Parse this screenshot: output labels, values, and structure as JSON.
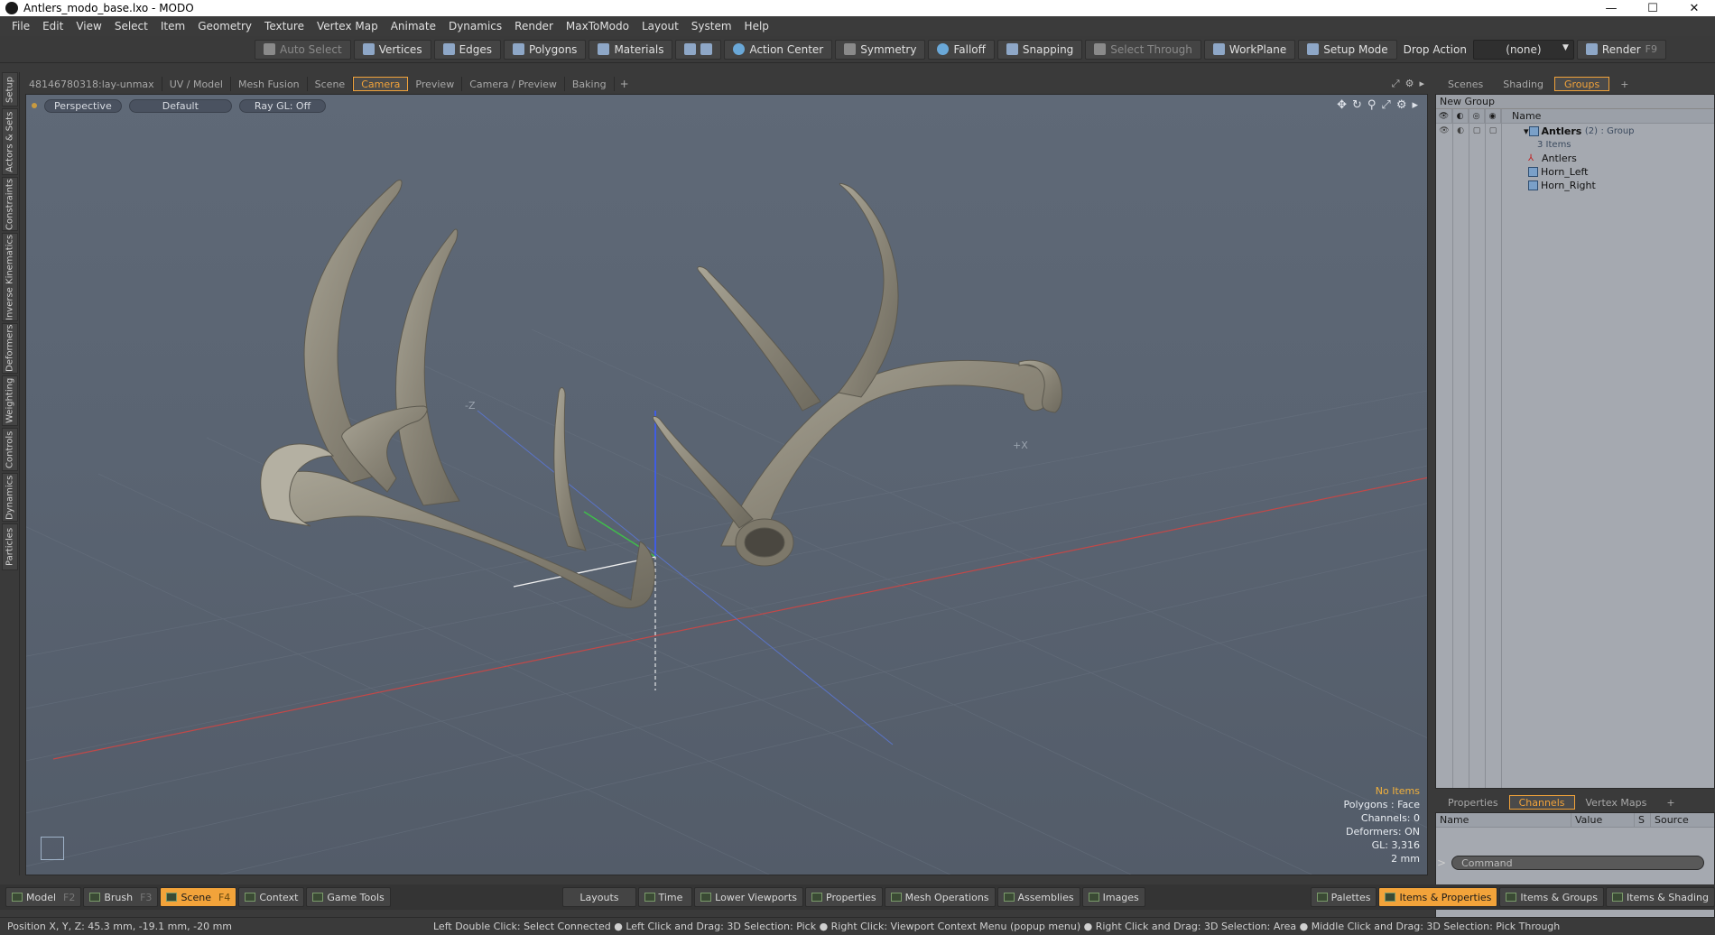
{
  "window": {
    "title": "Antlers_modo_base.lxo - MODO",
    "minimize": "—",
    "maximize": "☐",
    "close": "✕"
  },
  "menu": [
    "File",
    "Edit",
    "View",
    "Select",
    "Item",
    "Geometry",
    "Texture",
    "Vertex Map",
    "Animate",
    "Dynamics",
    "Render",
    "MaxToModo",
    "Layout",
    "System",
    "Help"
  ],
  "toolbar": {
    "auto_select": "Auto Select",
    "vertices": "Vertices",
    "edges": "Edges",
    "polygons": "Polygons",
    "materials": "Materials",
    "action_center": "Action Center",
    "symmetry": "Symmetry",
    "falloff": "Falloff",
    "snapping": "Snapping",
    "select_through": "Select Through",
    "workplane": "WorkPlane",
    "setup_mode": "Setup Mode",
    "drop_action": "Drop Action",
    "drop_value": "(none)",
    "render": "Render",
    "render_key": "F9"
  },
  "left_tabs": [
    "Setup",
    "Actors & Sets",
    "Constraints",
    "Inverse Kinematics",
    "Deformers",
    "Weighting",
    "Controls",
    "Dynamics",
    "Particles"
  ],
  "viewport_tabs": {
    "items": [
      "48146780318:lay-unmax",
      "UV / Model",
      "Mesh Fusion",
      "Scene",
      "Camera",
      "Preview",
      "Camera / Preview",
      "Baking"
    ],
    "active": "Camera",
    "add": "+"
  },
  "viewport": {
    "view_mode": "Perspective",
    "shading": "Default",
    "raygl": "Ray GL: Off",
    "axis_neg_z": "-Z",
    "axis_pos_x": "+X",
    "hud": {
      "selection": "No Items",
      "polygons": "Polygons : Face",
      "channels": "Channels: 0",
      "deformers": "Deformers: ON",
      "gl": "GL: 3,316",
      "scale": "2 mm"
    }
  },
  "right_tabs": {
    "items": [
      "Scenes",
      "Shading",
      "Groups"
    ],
    "active": "Groups",
    "add": "+"
  },
  "groups": {
    "new_group": "New Group",
    "name_col": "Name",
    "root": {
      "name": "Antlers",
      "count": "(2)",
      "type": ": Group",
      "sub": "3 Items"
    },
    "children": [
      "Antlers",
      "Horn_Left",
      "Horn_Right"
    ]
  },
  "channel_tabs": {
    "items": [
      "Properties",
      "Channels",
      "Vertex Maps"
    ],
    "active": "Channels",
    "add": "+"
  },
  "channels": {
    "cols": [
      "Name",
      "Value",
      "S",
      "Source"
    ]
  },
  "command": {
    "placeholder": "Command",
    "arrow": ">"
  },
  "bottom_bar": {
    "left": [
      {
        "label": "Model",
        "key": "F2"
      },
      {
        "label": "Brush",
        "key": "F3"
      },
      {
        "label": "Scene",
        "key": "F4",
        "active": true
      },
      {
        "label": "Context",
        "key": ""
      },
      {
        "label": "Game Tools",
        "key": ""
      }
    ],
    "middle": [
      "Layouts",
      "Time",
      "Lower Viewports",
      "Properties",
      "Mesh Operations",
      "Assemblies",
      "Images"
    ],
    "right": [
      "Palettes",
      "Items & Properties",
      "Items & Groups",
      "Items & Shading"
    ]
  },
  "status": {
    "position": "Position X, Y, Z:   45.3 mm, -19.1 mm, -20 mm",
    "hint": "Left Double Click: Select Connected ● Left Click and Drag: 3D Selection: Pick ● Right Click: Viewport Context Menu (popup menu) ● Right Click and Drag: 3D Selection: Area ● Middle Click and Drag: 3D Selection: Pick Through"
  },
  "colors": {
    "accent": "#f2a33a",
    "viewport_bg": "#5a6472",
    "antler": "#8a8577"
  }
}
